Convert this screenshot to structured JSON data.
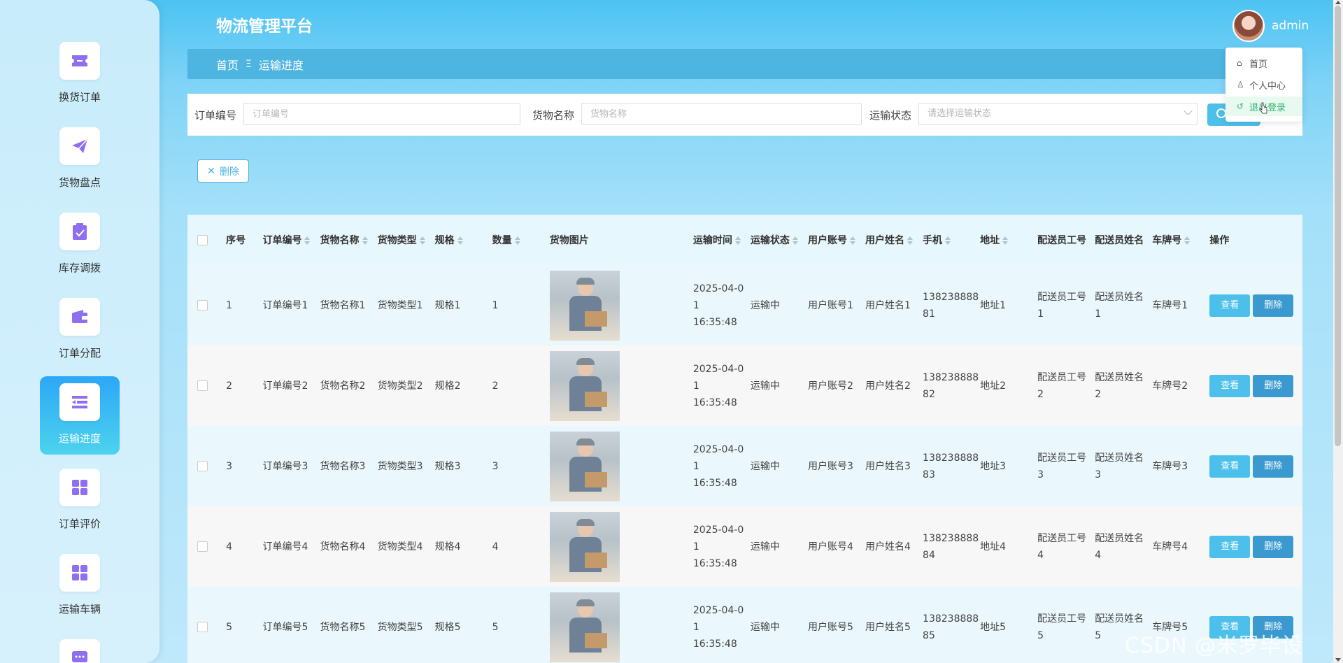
{
  "app": {
    "title": "物流管理平台",
    "username": "admin"
  },
  "sidebar": {
    "items": [
      {
        "label": "换货订单",
        "icon": "ticket-icon"
      },
      {
        "label": "货物盘点",
        "icon": "paper-plane-icon"
      },
      {
        "label": "库存调拨",
        "icon": "clipboard-check-icon"
      },
      {
        "label": "订单分配",
        "icon": "wallet-icon"
      },
      {
        "label": "运输进度",
        "icon": "list-icon",
        "active": true
      },
      {
        "label": "订单评价",
        "icon": "grid-icon"
      },
      {
        "label": "运输车辆",
        "icon": "grid-icon"
      }
    ]
  },
  "breadcrumb": {
    "home": "首页",
    "separator": "Ξ",
    "current": "运输进度"
  },
  "search": {
    "order_no_label": "订单编号",
    "order_no_placeholder": "订单编号",
    "goods_name_label": "货物名称",
    "goods_name_placeholder": "货物名称",
    "status_label": "运输状态",
    "status_placeholder": "请选择运输状态"
  },
  "toolbar": {
    "delete_label": "删除"
  },
  "user_menu": {
    "items": [
      "首页",
      "个人中心",
      "退出登录"
    ]
  },
  "table": {
    "columns": [
      "序号",
      "订单编号",
      "货物名称",
      "货物类型",
      "规格",
      "数量",
      "货物图片",
      "运输时间",
      "运输状态",
      "用户账号",
      "用户姓名",
      "手机",
      "地址",
      "配送员工号",
      "配送员姓名",
      "车牌号",
      "操作"
    ],
    "view_label": "查看",
    "delete_label": "删除",
    "rows": [
      {
        "no": "1",
        "order_no": "订单编号1",
        "goods_name": "货物名称1",
        "goods_type": "货物类型1",
        "spec": "规格1",
        "qty": "1",
        "time_a": "2025-04-0",
        "time_b": "1 16:35:48",
        "status": "运输中",
        "account": "用户账号1",
        "user_name": "用户姓名1",
        "phone_a": "138238888",
        "phone_b": "81",
        "address": "地址1",
        "courier_no_a": "配送员工号",
        "courier_no_b": "1",
        "courier_name_a": "配送员姓名",
        "courier_name_b": "1",
        "plate": "车牌号1"
      },
      {
        "no": "2",
        "order_no": "订单编号2",
        "goods_name": "货物名称2",
        "goods_type": "货物类型2",
        "spec": "规格2",
        "qty": "2",
        "time_a": "2025-04-0",
        "time_b": "1 16:35:48",
        "status": "运输中",
        "account": "用户账号2",
        "user_name": "用户姓名2",
        "phone_a": "138238888",
        "phone_b": "82",
        "address": "地址2",
        "courier_no_a": "配送员工号",
        "courier_no_b": "2",
        "courier_name_a": "配送员姓名",
        "courier_name_b": "2",
        "plate": "车牌号2"
      },
      {
        "no": "3",
        "order_no": "订单编号3",
        "goods_name": "货物名称3",
        "goods_type": "货物类型3",
        "spec": "规格3",
        "qty": "3",
        "time_a": "2025-04-0",
        "time_b": "1 16:35:48",
        "status": "运输中",
        "account": "用户账号3",
        "user_name": "用户姓名3",
        "phone_a": "138238888",
        "phone_b": "83",
        "address": "地址3",
        "courier_no_a": "配送员工号",
        "courier_no_b": "3",
        "courier_name_a": "配送员姓名",
        "courier_name_b": "3",
        "plate": "车牌号3"
      },
      {
        "no": "4",
        "order_no": "订单编号4",
        "goods_name": "货物名称4",
        "goods_type": "货物类型4",
        "spec": "规格4",
        "qty": "4",
        "time_a": "2025-04-0",
        "time_b": "1 16:35:48",
        "status": "运输中",
        "account": "用户账号4",
        "user_name": "用户姓名4",
        "phone_a": "138238888",
        "phone_b": "84",
        "address": "地址4",
        "courier_no_a": "配送员工号",
        "courier_no_b": "4",
        "courier_name_a": "配送员姓名",
        "courier_name_b": "4",
        "plate": "车牌号4"
      },
      {
        "no": "5",
        "order_no": "订单编号5",
        "goods_name": "货物名称5",
        "goods_type": "货物类型5",
        "spec": "规格5",
        "qty": "5",
        "time_a": "2025-04-0",
        "time_b": "1 16:35:48",
        "status": "运输中",
        "account": "用户账号5",
        "user_name": "用户姓名5",
        "phone_a": "138238888",
        "phone_b": "85",
        "address": "地址5",
        "courier_no_a": "配送员工号",
        "courier_no_b": "5",
        "courier_name_a": "配送员姓名",
        "courier_name_b": "5",
        "plate": "车牌号5"
      }
    ]
  },
  "watermark": "CSDN @米罗毕设",
  "colors": {
    "accent": "#4cc0ea",
    "active_nav": "#2da7f7",
    "menu_active": "#2bb573"
  }
}
